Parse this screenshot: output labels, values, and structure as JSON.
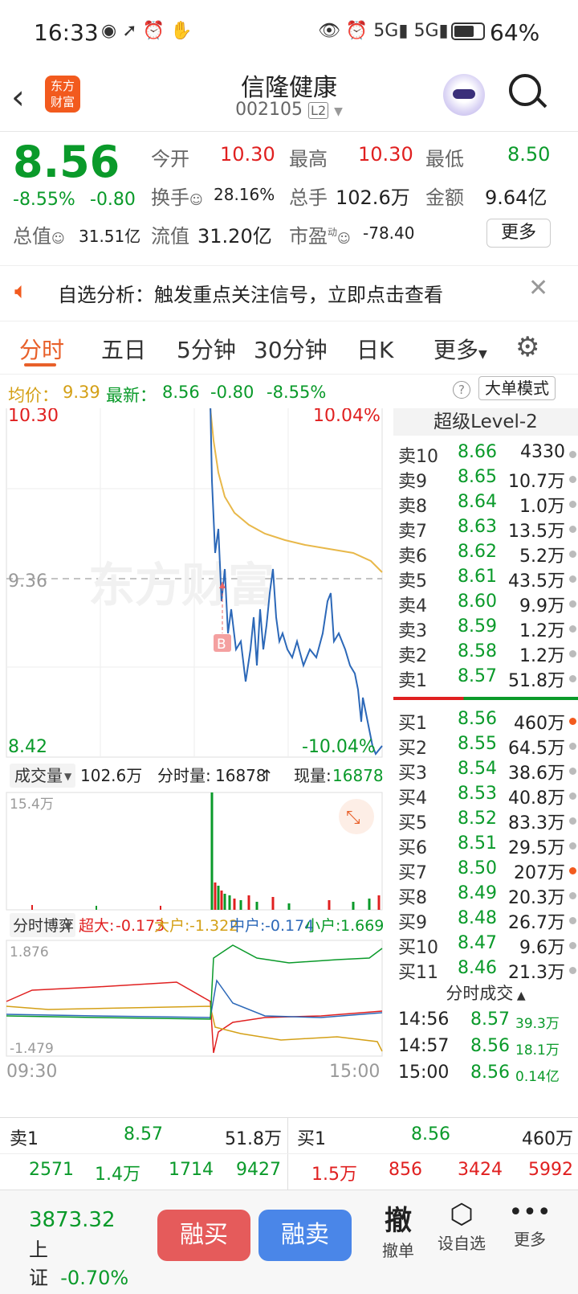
{
  "status": {
    "time": "16:33",
    "battery": "64%"
  },
  "header": {
    "title": "信隆健康",
    "code": "002105",
    "level_badge": "L2",
    "logo_text_1": "东方",
    "logo_text_2": "财富"
  },
  "quote": {
    "price": "8.56",
    "change_pct": "-8.55%",
    "change": "-0.80",
    "open_label": "今开",
    "open": "10.30",
    "high_label": "最高",
    "high": "10.30",
    "low_label": "最低",
    "low": "8.50",
    "turnover_label": "换手",
    "turnover": "28.16%",
    "volume_label": "总手",
    "volume": "102.6万",
    "amount_label": "金额",
    "amount": "9.64亿",
    "mcap_label": "总值",
    "mcap": "31.51亿",
    "float_label": "流值",
    "float_cap": "31.20亿",
    "pe_label": "市盈",
    "pe_sup": "动",
    "pe": "-78.40",
    "more_button": "更多"
  },
  "banner": {
    "text": "自选分析：触发重点关注信号，立即点击查看"
  },
  "tabs": [
    "分时",
    "五日",
    "5分钟",
    "30分钟",
    "日K",
    "更多"
  ],
  "infobar": {
    "avg_label": "均价：",
    "avg": "9.39",
    "latest_label": "最新：",
    "latest": "8.56",
    "chg": "-0.80",
    "pct": "-8.55%",
    "mode_button": "大单模式"
  },
  "chart": {
    "top_price": "10.30",
    "top_pct": "10.04%",
    "mid_price": "9.36",
    "bottom_price": "8.42",
    "bottom_pct": "-10.04%",
    "buy_marker": "B",
    "watermark": "东方财富",
    "vol_selector": "成交量",
    "vol_total": "102.6万",
    "tick_vol_label": "分时量:",
    "tick_vol": "16878",
    "now_vol_label": "现量:",
    "now_vol": "16878",
    "vol_max": "15.4万",
    "flow_selector": "分时博弈",
    "flow": {
      "super_label": "超大:",
      "super": "-0.173",
      "big_label": "大户:",
      "big": "-1.322",
      "mid_label": "中户:",
      "mid": "-0.174",
      "small_label": "小户:",
      "small": "1.669"
    },
    "flow_top": "1.876",
    "flow_bottom": "-1.479",
    "time_start": "09:30",
    "time_end": "15:00"
  },
  "book": {
    "title": "超级Level-2",
    "asks": [
      {
        "label": "卖10",
        "price": "8.66",
        "vol": "4330"
      },
      {
        "label": "卖9",
        "price": "8.65",
        "vol": "10.7万"
      },
      {
        "label": "卖8",
        "price": "8.64",
        "vol": "1.0万"
      },
      {
        "label": "卖7",
        "price": "8.63",
        "vol": "13.5万"
      },
      {
        "label": "卖6",
        "price": "8.62",
        "vol": "5.2万"
      },
      {
        "label": "卖5",
        "price": "8.61",
        "vol": "43.5万"
      },
      {
        "label": "卖4",
        "price": "8.60",
        "vol": "9.9万"
      },
      {
        "label": "卖3",
        "price": "8.59",
        "vol": "1.2万"
      },
      {
        "label": "卖2",
        "price": "8.58",
        "vol": "1.2万"
      },
      {
        "label": "卖1",
        "price": "8.57",
        "vol": "51.8万"
      }
    ],
    "bids": [
      {
        "label": "买1",
        "price": "8.56",
        "vol": "460万"
      },
      {
        "label": "买2",
        "price": "8.55",
        "vol": "64.5万"
      },
      {
        "label": "买3",
        "price": "8.54",
        "vol": "38.6万"
      },
      {
        "label": "买4",
        "price": "8.53",
        "vol": "40.8万"
      },
      {
        "label": "买5",
        "price": "8.52",
        "vol": "83.3万"
      },
      {
        "label": "买6",
        "price": "8.51",
        "vol": "29.5万"
      },
      {
        "label": "买7",
        "price": "8.50",
        "vol": "207万"
      },
      {
        "label": "买8",
        "price": "8.49",
        "vol": "20.3万"
      },
      {
        "label": "买9",
        "price": "8.48",
        "vol": "26.7万"
      },
      {
        "label": "买10",
        "price": "8.47",
        "vol": "9.6万"
      },
      {
        "label": "买11",
        "price": "8.46",
        "vol": "21.3万"
      }
    ],
    "trades_title": "分时成交",
    "trades": [
      {
        "time": "14:56",
        "price": "8.57",
        "vol": "39.3万"
      },
      {
        "time": "14:57",
        "price": "8.56",
        "vol": "18.1万"
      },
      {
        "time": "15:00",
        "price": "8.56",
        "vol": "0.14亿"
      }
    ]
  },
  "summary": {
    "ask_label": "卖1",
    "ask_price": "8.57",
    "ask_vol": "51.8万",
    "bid_label": "买1",
    "bid_price": "8.56",
    "bid_vol": "460万",
    "ask_nums": [
      "2571",
      "1.4万",
      "1714",
      "9427"
    ],
    "bid_nums": [
      "1.5万",
      "856",
      "3424",
      "5992"
    ]
  },
  "nav": {
    "index_value": "3873.32",
    "index_name": "上证",
    "index_pct": "-0.70%",
    "buy_button": "融买",
    "sell_button": "融卖",
    "cancel_icon_text": "撤",
    "cancel_label": "撤单",
    "watch_label": "设自选",
    "more_label": "更多"
  }
}
